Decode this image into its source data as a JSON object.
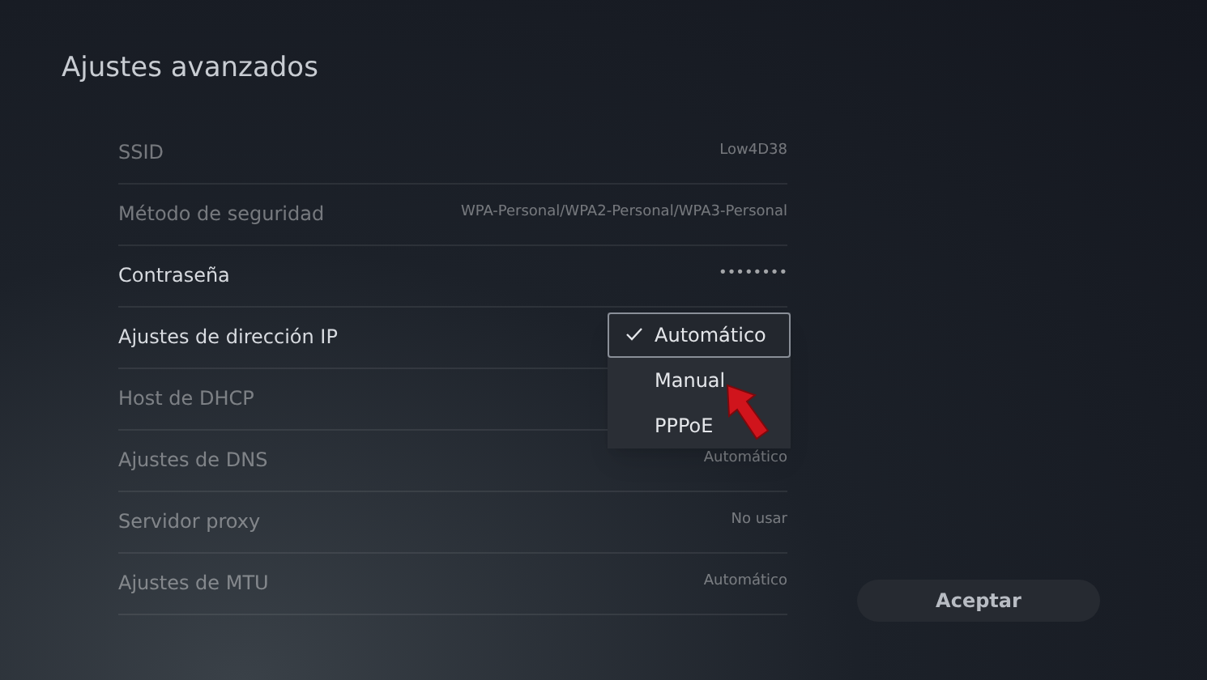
{
  "title": "Ajustes avanzados",
  "settings": [
    {
      "label": "SSID",
      "value": "Low4D38",
      "disabled": true
    },
    {
      "label": "Método de seguridad",
      "value": "WPA-Personal/WPA2-Personal/WPA3-Personal",
      "disabled": true
    },
    {
      "label": "Contraseña",
      "value": "••••••••",
      "disabled": false
    },
    {
      "label": "Ajustes de dirección IP",
      "disabled": false,
      "options": [
        {
          "label": "Automático",
          "selected": true
        },
        {
          "label": "Manual",
          "selected": false
        },
        {
          "label": "PPPoE",
          "selected": false
        }
      ]
    },
    {
      "label": "Host de DHCP",
      "disabled": true
    },
    {
      "label": "Ajustes de DNS",
      "value": "Automático",
      "disabled": true
    },
    {
      "label": "Servidor proxy",
      "value": "No usar",
      "disabled": true
    },
    {
      "label": "Ajustes de MTU",
      "value": "Automático",
      "disabled": true
    }
  ],
  "accept_button": "Aceptar"
}
